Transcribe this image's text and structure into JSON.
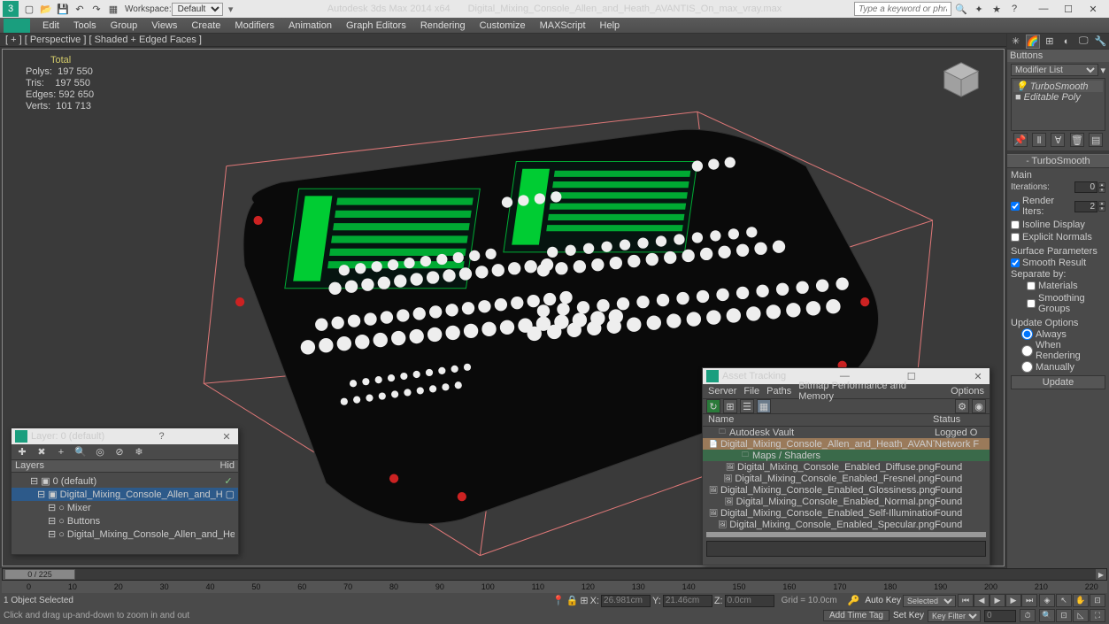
{
  "titlebar": {
    "workspace_label": "Workspace:",
    "workspace_value": "Default",
    "app_title": "Autodesk 3ds Max  2014 x64",
    "file_name": "Digital_Mixing_Console_Allen_and_Heath_AVANTIS_On_max_vray.max",
    "search_placeholder": "Type a keyword or phrase"
  },
  "menu": [
    "Edit",
    "Tools",
    "Group",
    "Views",
    "Create",
    "Modifiers",
    "Animation",
    "Graph Editors",
    "Rendering",
    "Customize",
    "MAXScript",
    "Help"
  ],
  "vp_label": "[ + ] [ Perspective ] [ Shaded + Edged Faces ]",
  "stats": {
    "header": "Total",
    "polys_label": "Polys:",
    "polys": "197 550",
    "tris_label": "Tris:",
    "tris": "197 550",
    "edges_label": "Edges:",
    "edges": "592 650",
    "verts_label": "Verts:",
    "verts": "101 713"
  },
  "cmd": {
    "buttons_header": "Buttons",
    "modlist_label": "Modifier List",
    "stack": [
      {
        "name": "TurboSmooth",
        "eye": "💡",
        "sel": true
      },
      {
        "name": "Editable Poly",
        "eye": "■",
        "sel": false
      }
    ],
    "turbosmooth_header": "TurboSmooth",
    "main_label": "Main",
    "iterations_label": "Iterations:",
    "iterations": "0",
    "render_iters_label": "Render Iters:",
    "render_iters": "2",
    "isoline_label": "Isoline Display",
    "explicit_label": "Explicit Normals",
    "surface_params_label": "Surface Parameters",
    "smooth_result_label": "Smooth Result",
    "separate_label": "Separate by:",
    "materials_label": "Materials",
    "smoothing_groups_label": "Smoothing Groups",
    "update_options_label": "Update Options",
    "always_label": "Always",
    "when_rendering_label": "When Rendering",
    "manually_label": "Manually",
    "update_button": "Update"
  },
  "layerdlg": {
    "title": "Layer: 0 (default)",
    "layers_col": "Layers",
    "hide_col": "Hid",
    "rows": [
      {
        "indent": 14,
        "icon": "▣",
        "name": "0 (default)",
        "check": "✓"
      },
      {
        "indent": 22,
        "icon": "▣",
        "name": "Digital_Mixing_Console_Allen_and_Heath_AVANTIS_Off",
        "sel": true,
        "extra": "▢"
      },
      {
        "indent": 34,
        "icon": "○",
        "name": "Mixer"
      },
      {
        "indent": 34,
        "icon": "○",
        "name": "Buttons"
      },
      {
        "indent": 34,
        "icon": "○",
        "name": "Digital_Mixing_Console_Allen_and_Heath_AVANTIS_Off"
      }
    ]
  },
  "assetdlg": {
    "title": "Asset Tracking",
    "menu": [
      "Server",
      "File",
      "Paths",
      "Bitmap Performance and Memory",
      "Options"
    ],
    "name_col": "Name",
    "status_col": "Status",
    "rows": [
      {
        "indent": 10,
        "icon": "🗀",
        "name": "Autodesk Vault",
        "status": "Logged O"
      },
      {
        "indent": 20,
        "icon": "📄",
        "name": "Digital_Mixing_Console_Allen_and_Heath_AVANTIS_On_max_vray.max",
        "status": "Network F",
        "hl": 1
      },
      {
        "indent": 36,
        "icon": "🗀",
        "name": "Maps / Shaders",
        "status": "",
        "hl": 2
      },
      {
        "indent": 46,
        "icon": "🖼",
        "name": "Digital_Mixing_Console_Enabled_Diffuse.png",
        "status": "Found"
      },
      {
        "indent": 46,
        "icon": "🖼",
        "name": "Digital_Mixing_Console_Enabled_Fresnel.png",
        "status": "Found"
      },
      {
        "indent": 46,
        "icon": "🖼",
        "name": "Digital_Mixing_Console_Enabled_Glossiness.png",
        "status": "Found"
      },
      {
        "indent": 46,
        "icon": "🖼",
        "name": "Digital_Mixing_Console_Enabled_Normal.png",
        "status": "Found"
      },
      {
        "indent": 46,
        "icon": "🖼",
        "name": "Digital_Mixing_Console_Enabled_Self-Illumination.png",
        "status": "Found"
      },
      {
        "indent": 46,
        "icon": "🖼",
        "name": "Digital_Mixing_Console_Enabled_Specular.png",
        "status": "Found"
      }
    ]
  },
  "bottom": {
    "slider_text": "0 / 225",
    "ticks": [
      "0",
      "10",
      "20",
      "30",
      "40",
      "50",
      "60",
      "70",
      "80",
      "90",
      "100",
      "110",
      "120",
      "130",
      "140",
      "150",
      "160",
      "170",
      "180",
      "190",
      "200",
      "210",
      "220"
    ],
    "selection_text": "1 Object Selected",
    "x_label": "X:",
    "x": "26.981cm",
    "y_label": "Y:",
    "y": "21.46cm",
    "z_label": "Z:",
    "z": "0.0cm",
    "grid_text": "Grid = 10.0cm",
    "autokey_label": "Auto Key",
    "setkey_label": "Set Key",
    "selected_label": "Selected",
    "key_filters_label": "Key Filters...",
    "add_time_tag": "Add Time Tag",
    "prompt": "Click and drag up-and-down to zoom in and out"
  }
}
